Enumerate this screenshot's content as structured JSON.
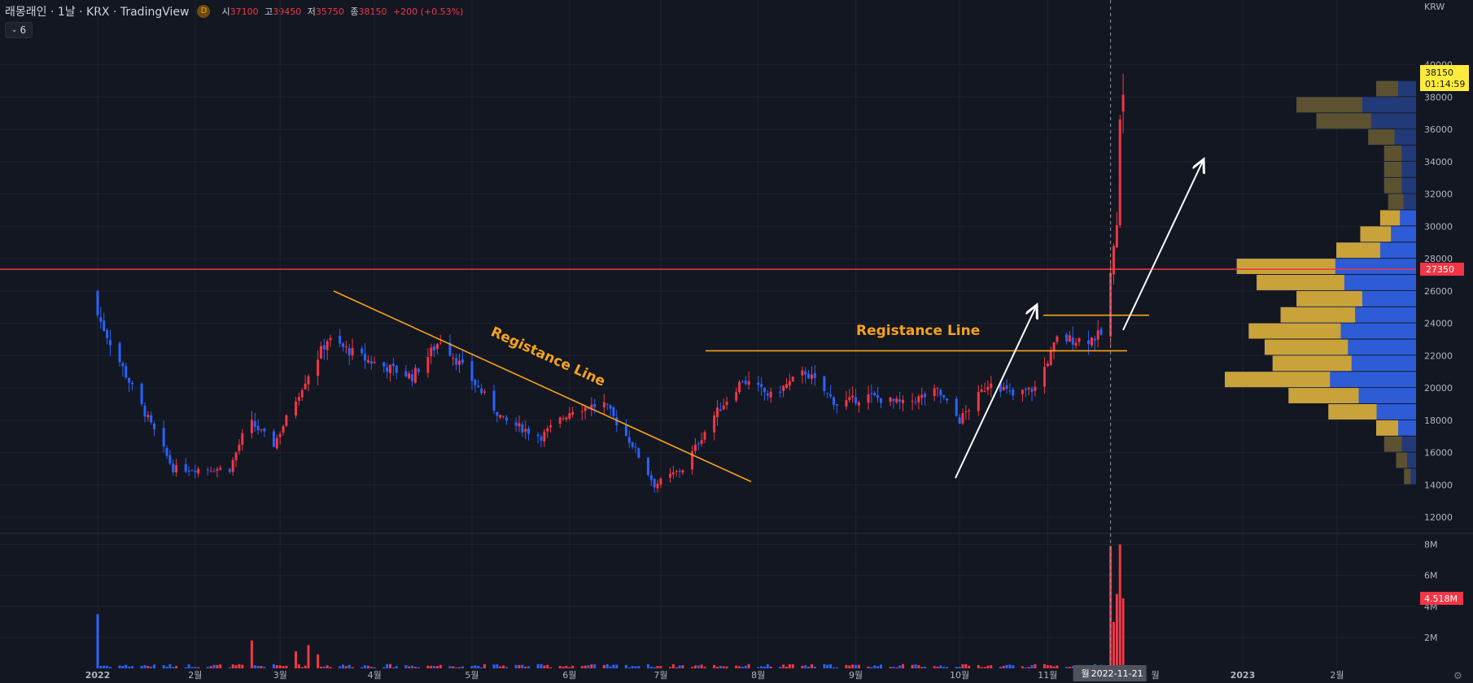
{
  "header": {
    "title": "래몽래인 · 1날 · KRX · TradingView",
    "badge": "D",
    "open_label": "시",
    "open": "37100",
    "high_label": "고",
    "high": "39450",
    "low_label": "저",
    "low": "35750",
    "close_label": "종",
    "close": "38150",
    "change": "+200 (+0.53%)",
    "indicator_toggle": "6"
  },
  "price_axis": {
    "currency": "KRW",
    "last_price": "38150",
    "countdown": "01:14:59",
    "level_price": "27350",
    "volume_label": "4.518M"
  },
  "crosshair": {
    "date_label": "2022-11-21",
    "day_prefix": "월",
    "partial_month": "월"
  },
  "colors": {
    "background": "#131722",
    "up": "#f23645",
    "down": "#2962ff",
    "trendline": "#f7a21b",
    "level_line": "#f23645",
    "text": "#b2b5be",
    "last_price_bg": "#ffeb3b"
  },
  "annotations": {
    "diag_label": "Registance Line",
    "horiz_label": "Registance Line"
  },
  "chart_data": [
    {
      "type": "candlestick",
      "title": "래몽래인 · 1날 · KRX",
      "x_labels": [
        "2022",
        "2월",
        "3월",
        "4월",
        "5월",
        "6월",
        "7월",
        "8월",
        "9월",
        "10월",
        "11월",
        "2023",
        "2월"
      ],
      "y_ticks": [
        12000,
        14000,
        16000,
        18000,
        20000,
        22000,
        24000,
        26000,
        28000,
        30000,
        32000,
        34000,
        36000,
        38000,
        40000
      ],
      "ylim": [
        11000,
        42500
      ],
      "checkpoints": [
        {
          "date": "2022-01-03",
          "close": 24500
        },
        {
          "date": "2022-01-14",
          "close": 20000
        },
        {
          "date": "2022-01-27",
          "close": 15000
        },
        {
          "date": "2022-02-14",
          "close": 15000
        },
        {
          "date": "2022-02-20",
          "close": 18000
        },
        {
          "date": "2022-02-28",
          "close": 16500
        },
        {
          "date": "2022-03-10",
          "close": 20500
        },
        {
          "date": "2022-03-17",
          "close": 23000
        },
        {
          "date": "2022-03-30",
          "close": 21700
        },
        {
          "date": "2022-04-13",
          "close": 20700
        },
        {
          "date": "2022-04-22",
          "close": 23000
        },
        {
          "date": "2022-05-02",
          "close": 20500
        },
        {
          "date": "2022-05-12",
          "close": 18000
        },
        {
          "date": "2022-05-24",
          "close": 17000
        },
        {
          "date": "2022-06-03",
          "close": 18700
        },
        {
          "date": "2022-06-13",
          "close": 19000
        },
        {
          "date": "2022-06-22",
          "close": 16500
        },
        {
          "date": "2022-06-29",
          "close": 14000
        },
        {
          "date": "2022-07-08",
          "close": 15000
        },
        {
          "date": "2022-07-18",
          "close": 18300
        },
        {
          "date": "2022-07-27",
          "close": 20500
        },
        {
          "date": "2022-08-05",
          "close": 19500
        },
        {
          "date": "2022-08-16",
          "close": 21000
        },
        {
          "date": "2022-08-26",
          "close": 19000
        },
        {
          "date": "2022-09-05",
          "close": 19500
        },
        {
          "date": "2022-09-16",
          "close": 19000
        },
        {
          "date": "2022-09-27",
          "close": 19800
        },
        {
          "date": "2022-10-04",
          "close": 18000
        },
        {
          "date": "2022-10-14",
          "close": 20500
        },
        {
          "date": "2022-10-21",
          "close": 19500
        },
        {
          "date": "2022-10-28",
          "close": 20000
        },
        {
          "date": "2022-11-04",
          "close": 23000
        },
        {
          "date": "2022-11-14",
          "close": 23000
        },
        {
          "date": "2022-11-18",
          "close": 23300
        },
        {
          "date": "2022-11-21",
          "close": 27000
        },
        {
          "date": "2022-11-22",
          "close": 28500
        },
        {
          "date": "2022-11-23",
          "close": 30500
        },
        {
          "date": "2022-11-24",
          "close": 37000
        },
        {
          "date": "2022-11-25",
          "close": 38150
        }
      ]
    },
    {
      "type": "bar",
      "title": "Volume",
      "y_ticks": [
        2000000,
        4000000,
        6000000,
        8000000
      ],
      "y_tick_labels": [
        "2M",
        "4M",
        "6M",
        "8M"
      ],
      "ylim": [
        0,
        8500000
      ],
      "spikes": [
        {
          "date": "2022-01-03",
          "value": 3500000
        },
        {
          "date": "2022-02-21",
          "value": 1800000
        },
        {
          "date": "2022-03-07",
          "value": 1100000
        },
        {
          "date": "2022-03-11",
          "value": 1500000
        },
        {
          "date": "2022-03-14",
          "value": 900000
        },
        {
          "date": "2022-11-21",
          "value": 7900000
        },
        {
          "date": "2022-11-22",
          "value": 3000000
        },
        {
          "date": "2022-11-23",
          "value": 4800000
        },
        {
          "date": "2022-11-24",
          "value": 8000000
        },
        {
          "date": "2022-11-25",
          "value": 4518000
        }
      ]
    },
    {
      "type": "bar",
      "title": "Volume Profile",
      "price_bins": [
        38000,
        37000,
        36000,
        35000,
        34000,
        33000,
        32000,
        31000,
        30000,
        29000,
        28000,
        27000,
        26000,
        25000,
        24000,
        23000,
        22000,
        21000,
        20000,
        19000,
        18000,
        17000,
        16000,
        15000,
        14000
      ],
      "values": [
        10,
        30,
        25,
        12,
        8,
        8,
        8,
        7,
        9,
        14,
        20,
        45,
        40,
        30,
        34,
        42,
        38,
        36,
        48,
        32,
        22,
        10,
        8,
        5,
        3
      ]
    }
  ]
}
